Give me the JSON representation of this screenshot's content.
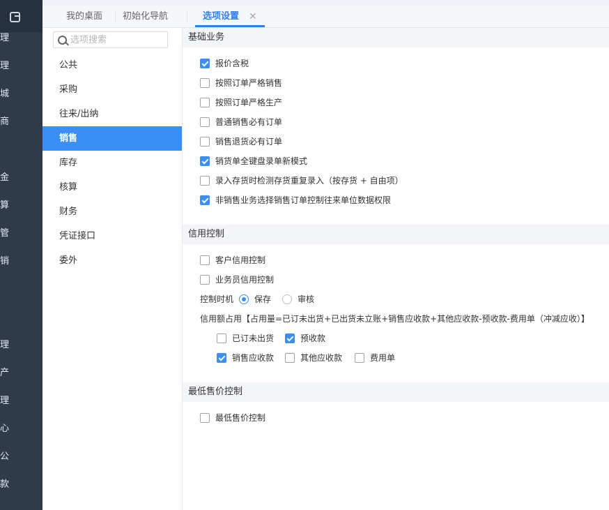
{
  "rail": {
    "items": [
      "理",
      "理",
      "城",
      "商",
      "金",
      "算",
      "管",
      "销",
      "理",
      "产",
      "理",
      "心",
      "公",
      "款"
    ]
  },
  "tabs": [
    {
      "label": "我的桌面"
    },
    {
      "label": "初始化导航"
    },
    {
      "label": "选项设置"
    }
  ],
  "tab_close": "✕",
  "search": {
    "placeholder": "选项搜索"
  },
  "sidebar": {
    "items": [
      {
        "label": "公共"
      },
      {
        "label": "采购"
      },
      {
        "label": "往来/出纳"
      },
      {
        "label": "销售"
      },
      {
        "label": "库存"
      },
      {
        "label": "核算"
      },
      {
        "label": "财务"
      },
      {
        "label": "凭证接口"
      },
      {
        "label": "委外"
      }
    ]
  },
  "sections": {
    "basic": {
      "title": "基础业务",
      "options": [
        {
          "label": "报价含税",
          "checked": true
        },
        {
          "label": "按照订单严格销售",
          "checked": false
        },
        {
          "label": "按照订单严格生产",
          "checked": false
        },
        {
          "label": "普通销售必有订单",
          "checked": false
        },
        {
          "label": "销售退货必有订单",
          "checked": false
        },
        {
          "label": "销货单全键盘录单新模式",
          "checked": true
        },
        {
          "label": "录入存货时检测存货重复录入（按存货 + 自由项）",
          "checked": false
        },
        {
          "label": "非销售业务选择销售订单控制往来单位数据权限",
          "checked": true
        }
      ]
    },
    "credit": {
      "title": "信用控制",
      "options": [
        {
          "label": "客户信用控制",
          "checked": false
        },
        {
          "label": "业务员信用控制",
          "checked": false
        }
      ],
      "timing_label": "控制时机",
      "timing_options": [
        {
          "label": "保存",
          "selected": true
        },
        {
          "label": "审核",
          "selected": false
        }
      ],
      "formula": "信用额占用【占用量=已订未出货+已出货未立账+销售应收款+其他应收款-预收款-费用单（冲减应收）】",
      "items": [
        {
          "label": "已订未出货",
          "checked": false
        },
        {
          "label": "预收款",
          "checked": true
        },
        {
          "label": "销售应收款",
          "checked": true
        },
        {
          "label": "其他应收款",
          "checked": false
        },
        {
          "label": "费用单",
          "checked": false
        }
      ]
    },
    "minprice": {
      "title": "最低售价控制",
      "options": [
        {
          "label": "最低售价控制",
          "checked": false
        }
      ]
    }
  }
}
